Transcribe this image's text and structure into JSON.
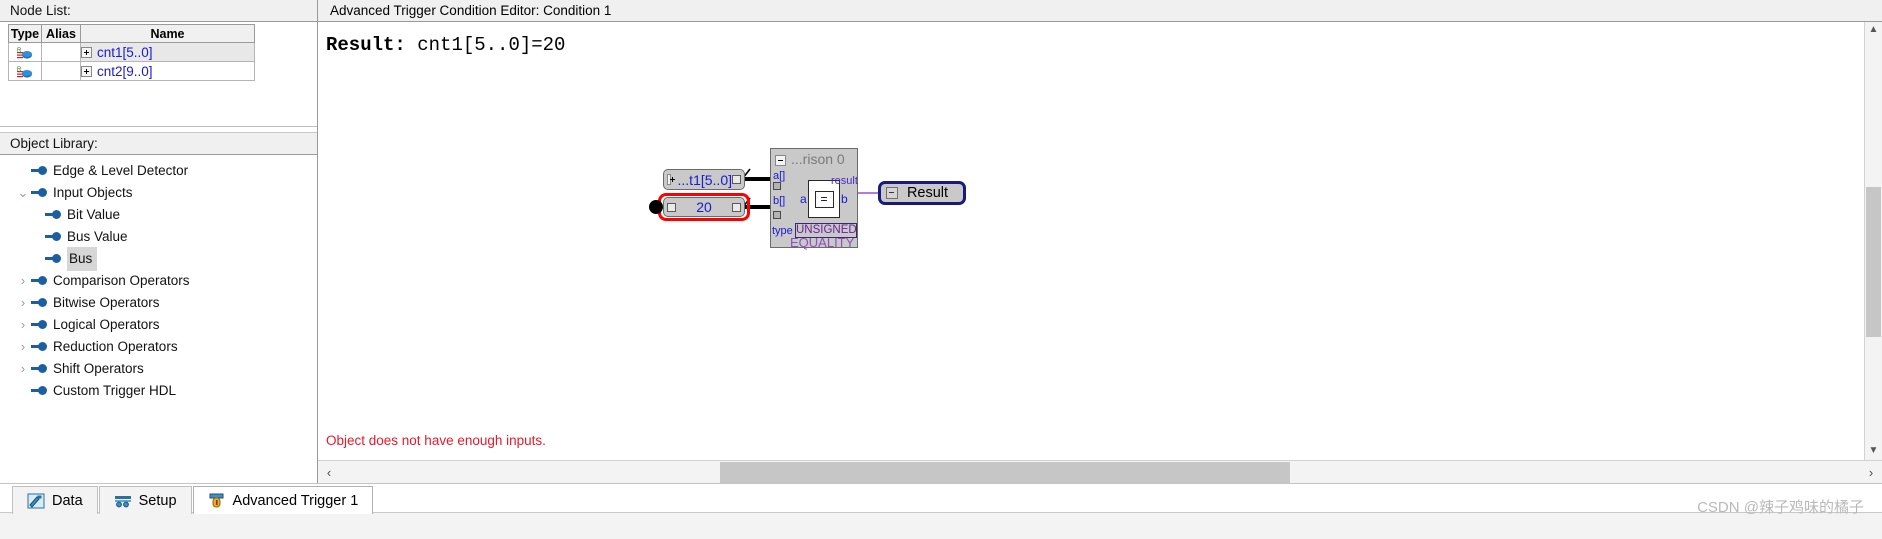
{
  "node_list": {
    "header": "Node List:",
    "columns": [
      "Type",
      "Alias",
      "Name"
    ],
    "rows": [
      {
        "type_icon": "bus-node-icon",
        "alias": "",
        "name": "cnt1[5..0]",
        "expandable": true,
        "selected": true
      },
      {
        "type_icon": "bus-node-icon",
        "alias": "",
        "name": "cnt2[9..0]",
        "expandable": true,
        "selected": false
      }
    ]
  },
  "object_library": {
    "header": "Object Library:",
    "items": [
      {
        "label": "Edge & Level Detector",
        "level": 0,
        "chevron": "none",
        "selected": false
      },
      {
        "label": "Input Objects",
        "level": 0,
        "chevron": "down",
        "selected": false
      },
      {
        "label": "Bit Value",
        "level": 1,
        "chevron": "none",
        "selected": false
      },
      {
        "label": "Bus Value",
        "level": 1,
        "chevron": "none",
        "selected": false
      },
      {
        "label": "Bus",
        "level": 1,
        "chevron": "none",
        "selected": true
      },
      {
        "label": "Comparison Operators",
        "level": 0,
        "chevron": "right",
        "selected": false
      },
      {
        "label": "Bitwise Operators",
        "level": 0,
        "chevron": "right",
        "selected": false
      },
      {
        "label": "Logical Operators",
        "level": 0,
        "chevron": "right",
        "selected": false
      },
      {
        "label": "Reduction Operators",
        "level": 0,
        "chevron": "right",
        "selected": false
      },
      {
        "label": "Shift Operators",
        "level": 0,
        "chevron": "right",
        "selected": false
      },
      {
        "label": "Custom Trigger HDL",
        "level": 0,
        "chevron": "none",
        "selected": false
      }
    ]
  },
  "editor": {
    "title": "Advanced Trigger Condition Editor: Condition 1",
    "result_label": "Result:",
    "result_expression": "cnt1[5..0]=20",
    "error_message": "Object does not have enough inputs.",
    "scroll_left_arrow": "‹",
    "scroll_right_arrow": "›",
    "scroll_up_arrow": "▲",
    "scroll_down_arrow": "▼"
  },
  "diagram": {
    "input_bus_node": {
      "label": "...t1[5..0]",
      "expand_icon": "plus-box-icon"
    },
    "value_node": {
      "label": "20",
      "selected": true,
      "selection_color": "#ff0000"
    },
    "comparison_block": {
      "title": "...rison  0",
      "collapse_icon": "minus-box-icon",
      "input_a": "a[]",
      "input_b": "b[]",
      "port_a": "a",
      "port_b": "b",
      "operator": "=",
      "output": "result",
      "type_label": "type",
      "type_value": "UNSIGNED",
      "operation": "EQUALITY",
      "wire_color": "#1f8fe0",
      "result_wire_color": "#9b4fd0"
    },
    "result_node": {
      "label": "Result",
      "border_color": "#1a1a7a",
      "collapse_icon": "minus-box-icon"
    }
  },
  "tabs": [
    {
      "label": "Data",
      "icon": "data-tab-icon",
      "active": false
    },
    {
      "label": "Setup",
      "icon": "setup-tab-icon",
      "active": false
    },
    {
      "label": "Advanced Trigger 1",
      "icon": "trigger-tab-icon",
      "active": true
    }
  ],
  "watermark": "CSDN @辣子鸡味的橘子"
}
